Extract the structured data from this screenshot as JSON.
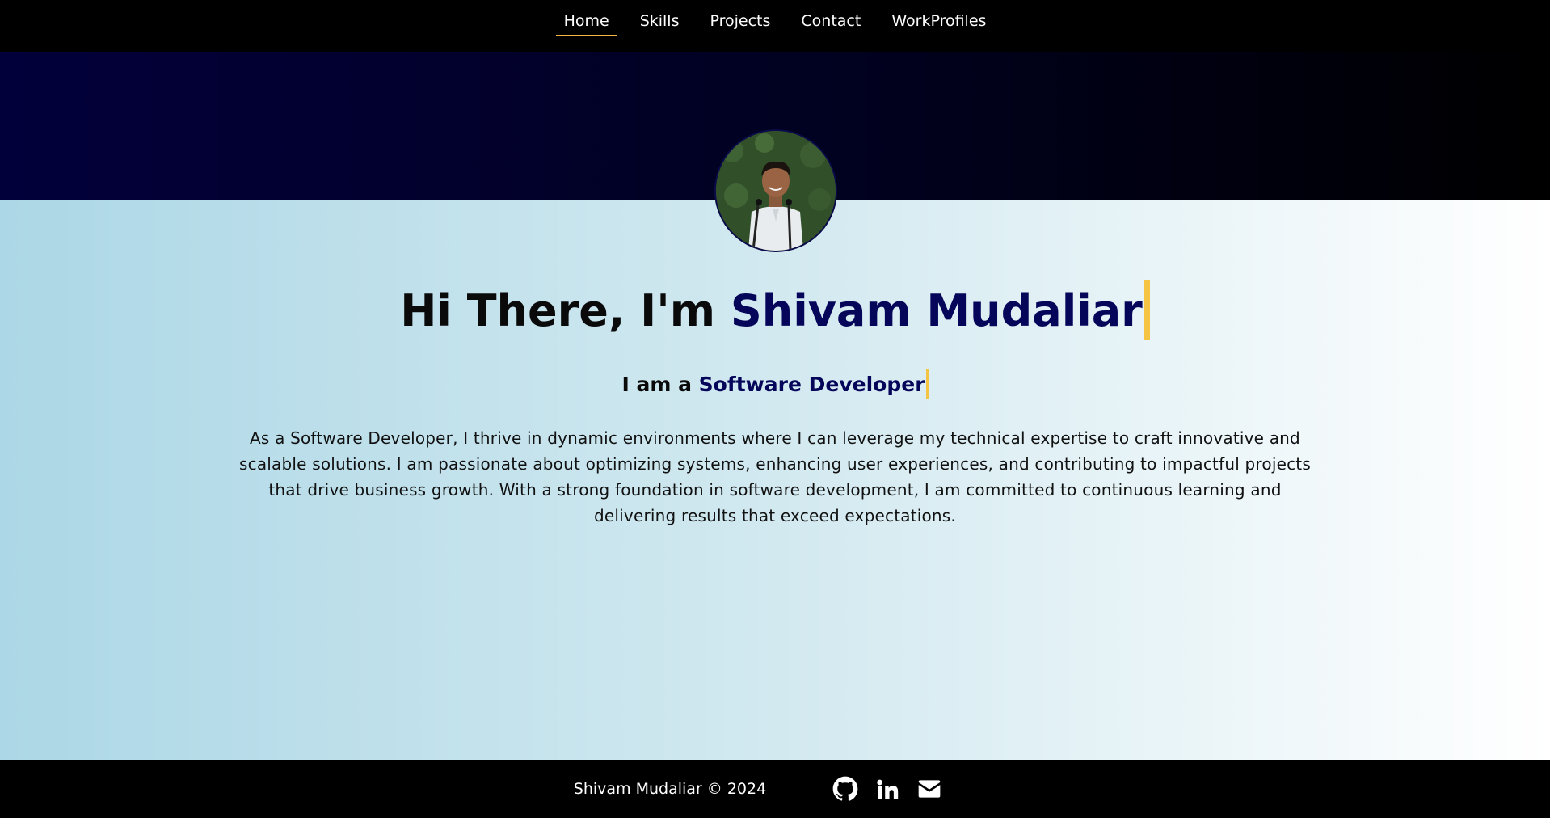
{
  "nav": {
    "items": [
      {
        "label": "Home",
        "active": true
      },
      {
        "label": "Skills",
        "active": false
      },
      {
        "label": "Projects",
        "active": false
      },
      {
        "label": "Contact",
        "active": false
      },
      {
        "label": "WorkProfiles",
        "active": false
      }
    ]
  },
  "hero": {
    "title_prefix": "Hi There, I'm ",
    "name": "Shivam Mudaliar",
    "subtitle_prefix": "I am a ",
    "role": "Software Developer",
    "description": "As a Software Developer, I thrive in dynamic environments where I can leverage my technical expertise to craft innovative and scalable solutions. I am passionate about optimizing systems, enhancing user experiences, and contributing to impactful projects that drive business growth. With a strong foundation in software development, I am committed to continuous learning and delivering results that exceed expectations."
  },
  "footer": {
    "copyright": "Shivam Mudaliar © 2024",
    "social": [
      {
        "icon": "github-icon"
      },
      {
        "icon": "linkedin-icon"
      },
      {
        "icon": "envelope-icon"
      }
    ]
  },
  "colors": {
    "accent_name": "#05055a",
    "caret": "#f5c443",
    "nav_active_underline": "#f5b63b",
    "hero_dark": "#02003a",
    "hero_light_start": "#acd7e6",
    "hero_light_end": "#ffffff"
  }
}
